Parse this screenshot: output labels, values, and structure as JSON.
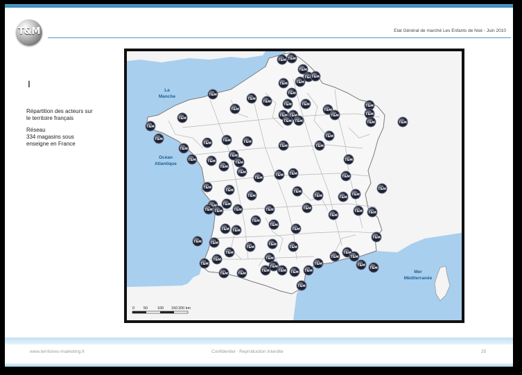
{
  "header": {
    "logo_text": "T&M",
    "title": "Etat Général de marché  Les Enfants de Noé - Juin 2010"
  },
  "sidebar": {
    "section_mark": "I",
    "line1": "Répartition des acteurs sur",
    "line2": "le territoire français",
    "line3": "Réseau",
    "line4": "334 magasins sous",
    "line5": "enseigne en France"
  },
  "map": {
    "sea_labels": {
      "manche_line1": "La",
      "manche_line2": "Manche",
      "ocean_line1": "Océan",
      "ocean_line2": "Atlantique",
      "med_line1": "Mer",
      "med_line2": "Méditerranée"
    },
    "scale_labels": [
      "0",
      "50",
      "100",
      "150",
      "200 km"
    ],
    "marker_label": "T&M",
    "colors": {
      "sea": "#a9cfee",
      "land": "#f4f4f4",
      "border": "#b5b5b5",
      "marker": "#1d2233"
    }
  },
  "footer": {
    "website": "www.territoires-marketing.fr",
    "confidential": "Confidentiel - Reproduction interdite",
    "page_number": "25"
  }
}
